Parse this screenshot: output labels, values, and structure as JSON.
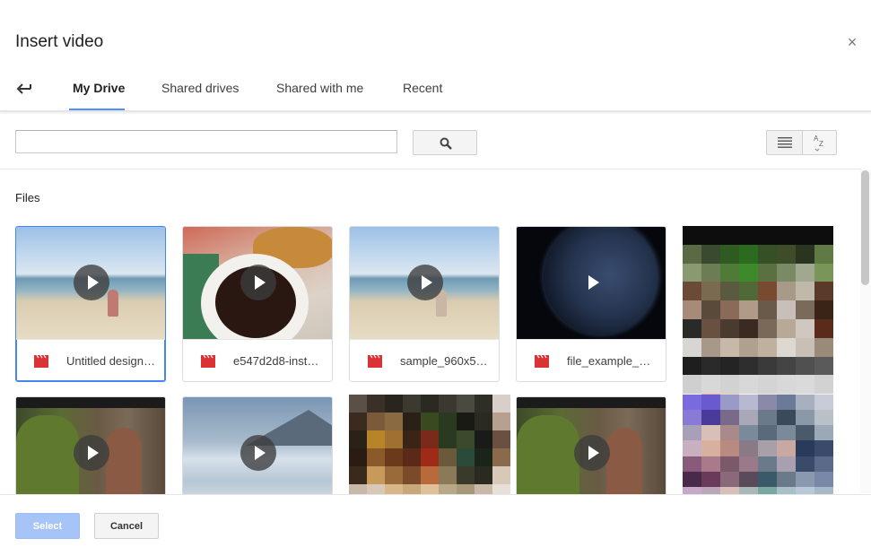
{
  "dialog": {
    "title": "Insert video",
    "close_icon": "close-icon",
    "back_icon": "back-arrow-icon"
  },
  "tabs": [
    {
      "label": "My Drive",
      "active": true
    },
    {
      "label": "Shared drives",
      "active": false
    },
    {
      "label": "Shared with me",
      "active": false
    },
    {
      "label": "Recent",
      "active": false
    }
  ],
  "search": {
    "value": "",
    "placeholder": "",
    "button_icon": "search-icon"
  },
  "view_controls": {
    "list_icon": "list-view-icon",
    "sort_icon": "sort-az-icon",
    "sort_glyph_top": "A",
    "sort_glyph_bottom": "Z"
  },
  "files_section": {
    "label": "Files",
    "items": [
      {
        "name": "Untitled design…",
        "type": "video",
        "selected": true
      },
      {
        "name": "e547d2d8-inst…",
        "type": "video",
        "selected": false
      },
      {
        "name": "sample_960x5…",
        "type": "video",
        "selected": false
      },
      {
        "name": "file_example_…",
        "type": "video",
        "selected": false
      }
    ]
  },
  "footer": {
    "select_label": "Select",
    "cancel_label": "Cancel"
  },
  "colors": {
    "accent": "#4285f4",
    "tab_underline": "#4d90fe",
    "select_disabled": "#a7c4f8",
    "video_icon_red": "#db3236"
  }
}
